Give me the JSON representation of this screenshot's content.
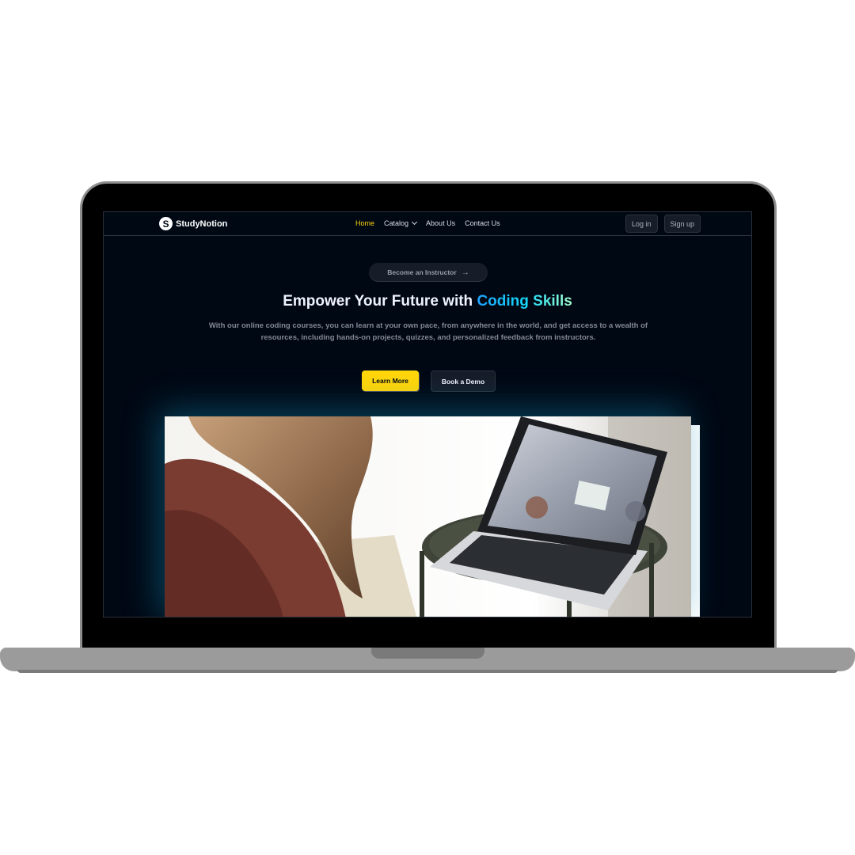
{
  "brand": {
    "name": "StudyNotion",
    "logo_letter": "S"
  },
  "nav": {
    "links": [
      {
        "label": "Home",
        "active": true
      },
      {
        "label": "Catalog",
        "has_dropdown": true
      },
      {
        "label": "About Us"
      },
      {
        "label": "Contact Us"
      }
    ],
    "login_label": "Log in",
    "signup_label": "Sign up"
  },
  "hero": {
    "instructor_pill": "Become an Instructor",
    "arrow_icon": "arrow-right-icon",
    "headline_prefix": "Empower Your Future with ",
    "headline_accent": "Coding Skills",
    "subtext": "With our online coding courses, you can learn at your own pace, from anywhere in the world, and get access to a wealth of resources, including hands-on projects, quizzes, and personalized feedback from instructors.",
    "primary_cta": "Learn More",
    "secondary_cta": "Book a Demo"
  },
  "colors": {
    "background": "#000814",
    "accent_yellow": "#ffd60a",
    "accent_gradient": [
      "#1fa2ff",
      "#12d8fa",
      "#a6ffcb"
    ],
    "surface": "#161d29"
  }
}
